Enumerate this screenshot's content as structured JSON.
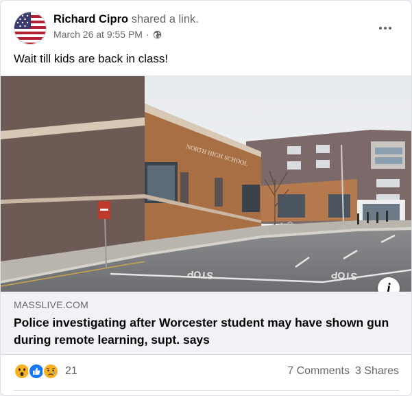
{
  "post": {
    "author": "Richard Cipro",
    "action": "shared a link.",
    "timestamp": "March 26 at 9:55 PM",
    "separator": "·",
    "privacy_icon": "globe-icon",
    "text": "Wait till kids are back in class!"
  },
  "link": {
    "domain": "MASSLIVE.COM",
    "headline": "Police investigating after Worcester student may have shown gun during remote learning, supt. says",
    "image_sign": "NORTH HIGH SCHOOL",
    "road_marking": "STOP",
    "info_label": "i"
  },
  "engagement": {
    "reaction_icons": [
      "wow-icon",
      "like-icon",
      "sad-icon"
    ],
    "reaction_count": "21",
    "comments": "7 Comments",
    "shares": "3 Shares"
  },
  "colors": {
    "like_blue": "#1877f2",
    "emoji_yellow": "#f7b125",
    "text_secondary": "#65676b"
  }
}
